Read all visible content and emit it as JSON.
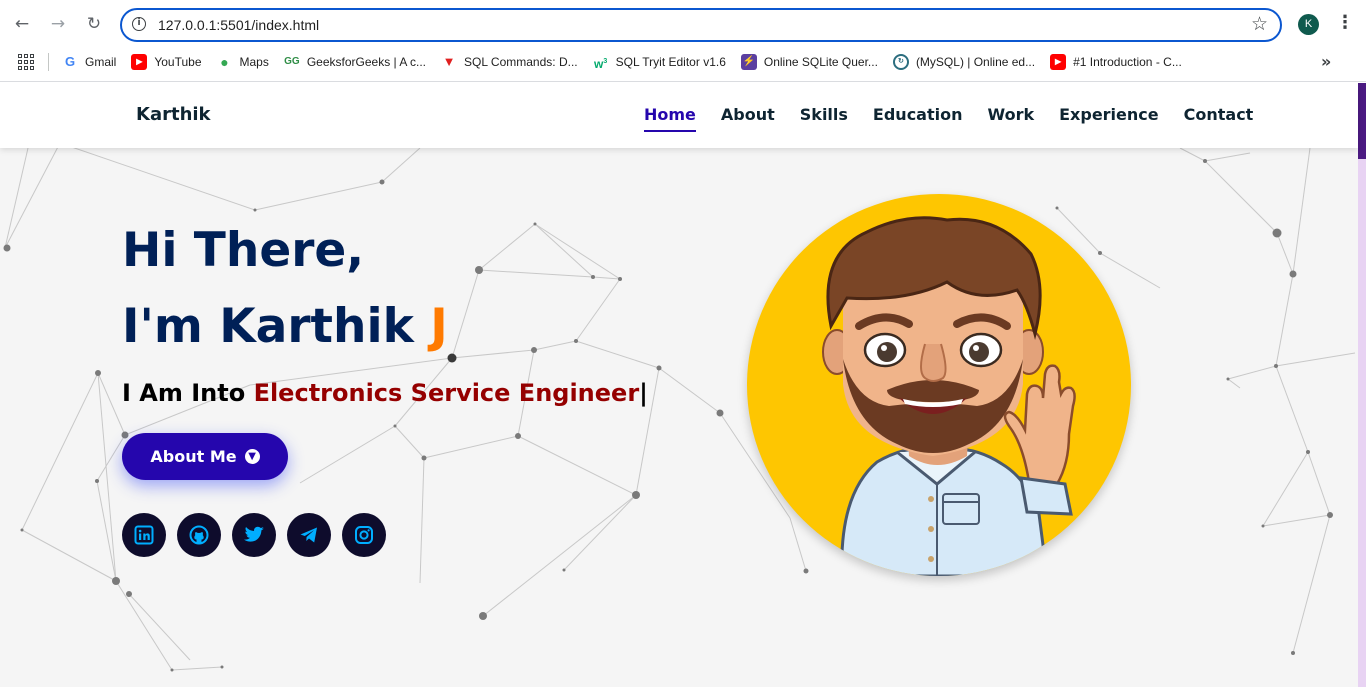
{
  "browser": {
    "url": "127.0.0.1:5501/index.html",
    "profile_initial": "K",
    "bookmarks": [
      {
        "label": "Gmail",
        "icon": "google-icon"
      },
      {
        "label": "YouTube",
        "icon": "youtube-icon"
      },
      {
        "label": "Maps",
        "icon": "maps-icon"
      },
      {
        "label": "GeeksforGeeks | A c...",
        "icon": "gfg-icon"
      },
      {
        "label": "SQL Commands: D...",
        "icon": "sql-commands-icon"
      },
      {
        "label": "SQL Tryit Editor v1.6",
        "icon": "w3schools-icon"
      },
      {
        "label": "Online SQLite Quer...",
        "icon": "sqlite-icon"
      },
      {
        "label": "(MySQL) | Online ed...",
        "icon": "mysql-online-icon"
      },
      {
        "label": "#1 Introduction - C...",
        "icon": "youtube-icon"
      }
    ]
  },
  "site": {
    "brand": "Karthik",
    "nav": [
      "Home",
      "About",
      "Skills",
      "Education",
      "Work",
      "Experience",
      "Contact"
    ],
    "active_nav": "Home",
    "hero": {
      "line1": "Hi There,",
      "line2_prefix": "I'm Karthik ",
      "line2_accent": "J",
      "typing_prefix": "I Am Into ",
      "typing_role": "Electronics Service Engineer",
      "cursor": "|",
      "button_label": "About Me"
    },
    "socials": [
      "linkedin-icon",
      "github-icon",
      "twitter-icon",
      "telegram-icon",
      "instagram-icon"
    ]
  },
  "colors": {
    "primary": "#2506ad",
    "heading": "#002057",
    "accent": "#ff7a00",
    "role": "#950000",
    "avatar_bg": "#fec601",
    "social_bg": "#0e0c2c",
    "social_icon": "#00aeff"
  }
}
